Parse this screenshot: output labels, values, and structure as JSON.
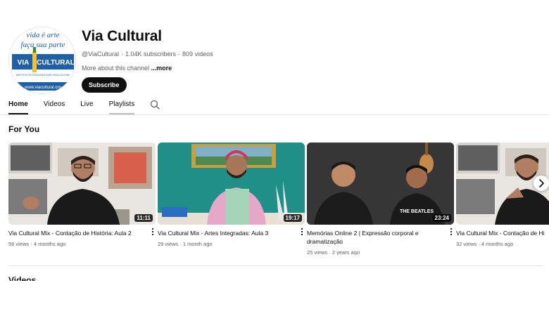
{
  "channel": {
    "name": "Via Cultural",
    "handle": "@ViaCultural",
    "subscribers": "1.04K subscribers",
    "videos_count": "809 videos",
    "about_label": "More about this channel",
    "more_label": "...more",
    "subscribe_label": "Subscribe"
  },
  "avatar": {
    "line1": "vida é arte",
    "line2": "faça sua parte",
    "logo_via": "VIA",
    "logo_cultural": "CULTURAL",
    "tagline": "INSTITUTO DE PESQUISA E AÇÃO PELA CULTURA",
    "url": "www.viacultural.org"
  },
  "tabs": [
    {
      "label": "Home",
      "active": true
    },
    {
      "label": "Videos",
      "active": false
    },
    {
      "label": "Live",
      "active": false
    },
    {
      "label": "Playlists",
      "active": false
    }
  ],
  "sections": {
    "for_you": "For You",
    "videos": "Videos"
  },
  "videos": [
    {
      "title": "Via Cultural Mix - Contação de História: Aula 2",
      "views": "56 views",
      "age": "4 months ago",
      "duration": "11:11"
    },
    {
      "title": "Via Cultural Mix - Artes Integradas: Aula 3",
      "views": "29 views",
      "age": "1 month ago",
      "duration": "19:17"
    },
    {
      "title": "Memórias Online 2 | Expressão corporal e dramatização",
      "views": "25 views",
      "age": "2 years ago",
      "duration": "23:24"
    },
    {
      "title": "Via Cultural Mix - Contação de Hi",
      "views": "32 views",
      "age": "4 months ago",
      "duration": ""
    }
  ],
  "shirt_text": "THE BEATLES",
  "colors": {
    "text": "#0f0f0f",
    "secondary_text": "#606060",
    "subscribe_bg": "#0f0f0f",
    "logo_blue": "#1f5fa8",
    "divider": "#e5e5e5"
  }
}
